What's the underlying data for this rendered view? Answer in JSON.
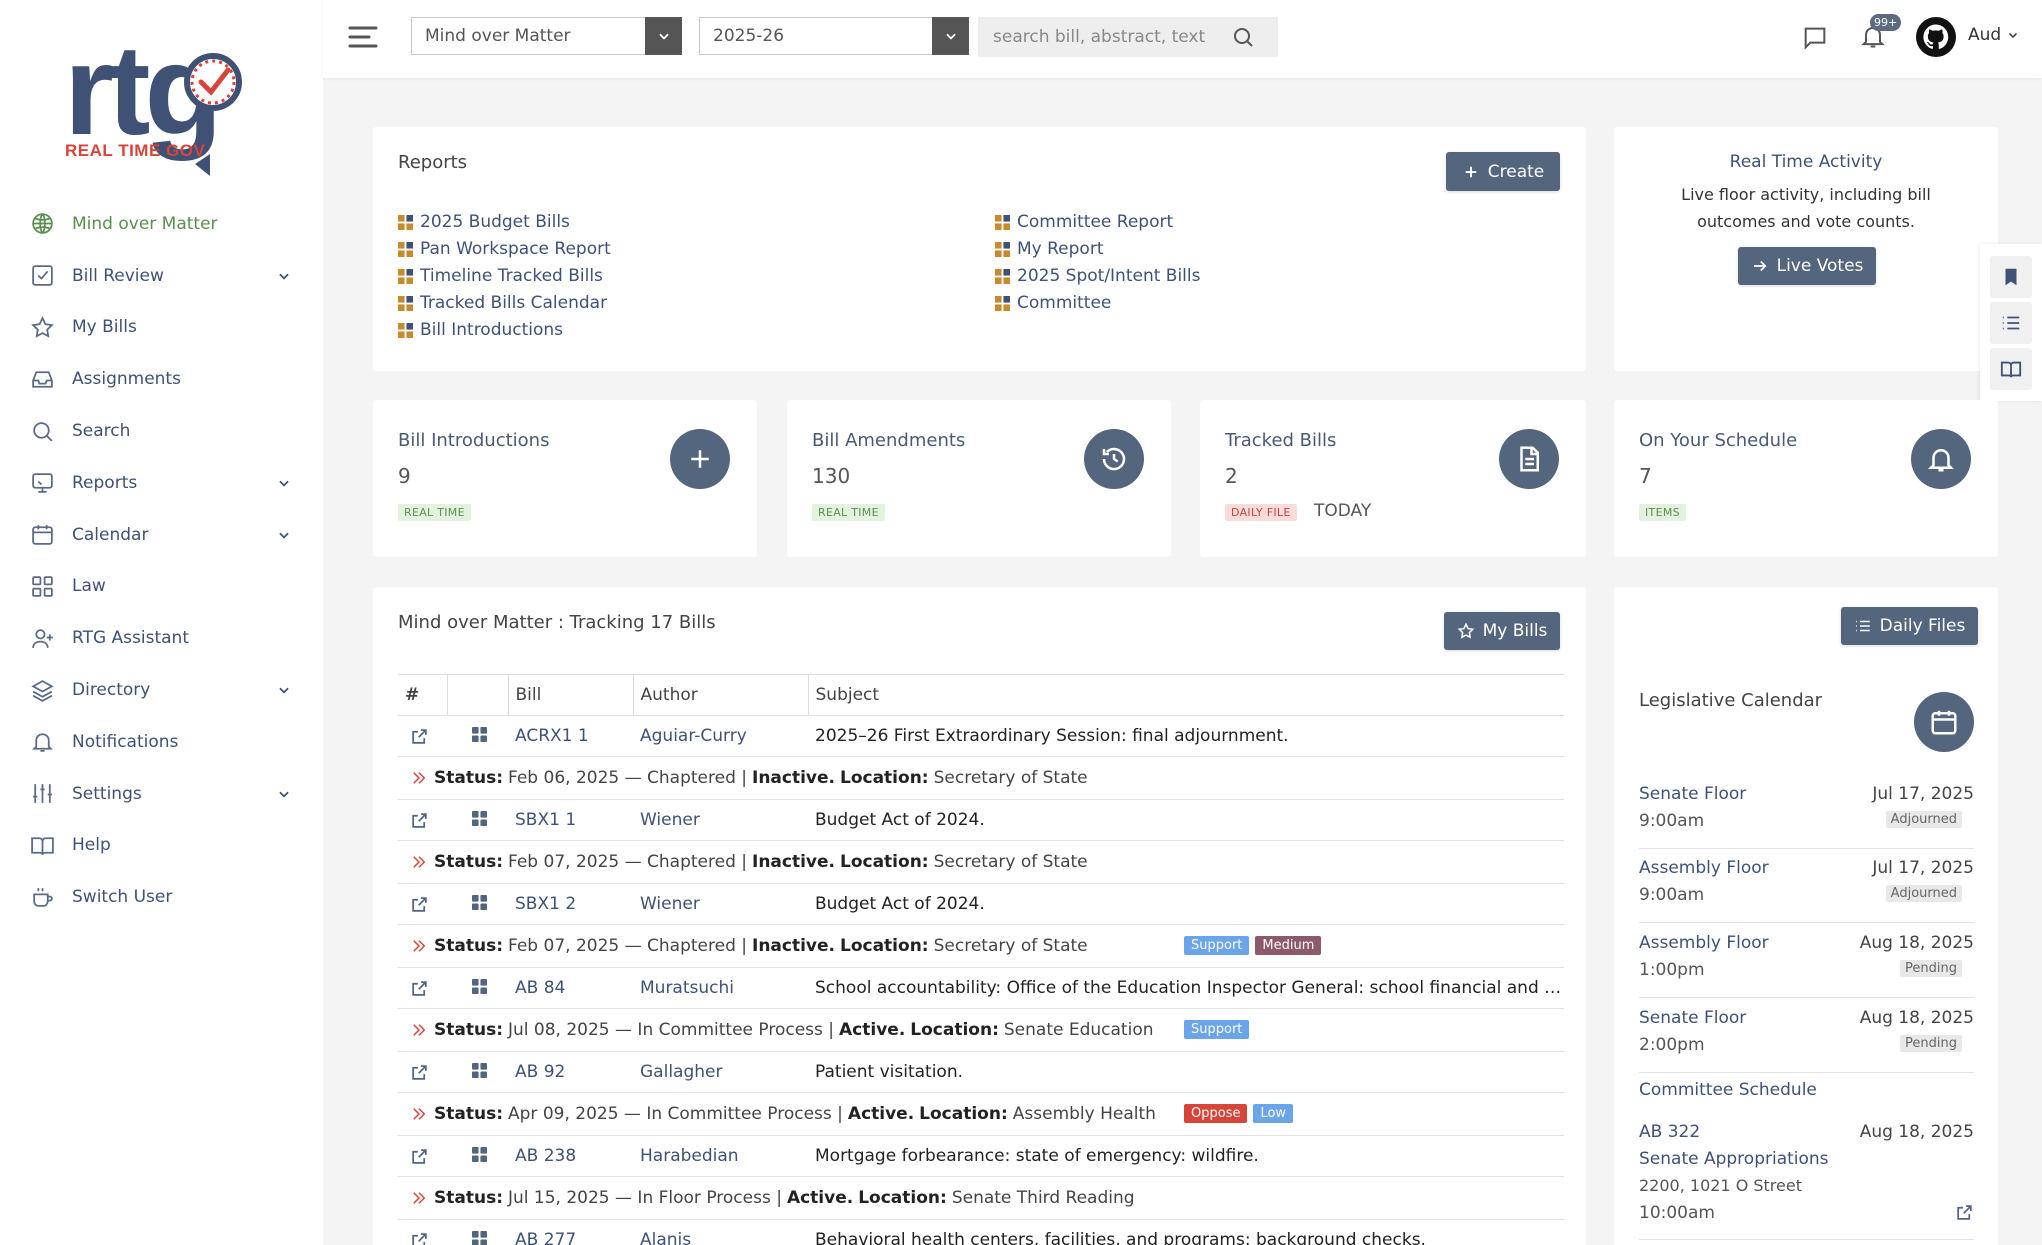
{
  "logo": {
    "text": "rtg",
    "subtitle": "REAL TIME GOV"
  },
  "sidebar": {
    "items": [
      {
        "label": "Mind over Matter",
        "icon": "globe-icon",
        "active": true,
        "chevron": false
      },
      {
        "label": "Bill Review",
        "icon": "checklist-icon",
        "chevron": true
      },
      {
        "label": "My Bills",
        "icon": "star-icon",
        "chevron": false
      },
      {
        "label": "Assignments",
        "icon": "inbox-icon",
        "chevron": false
      },
      {
        "label": "Search",
        "icon": "search-icon",
        "chevron": false
      },
      {
        "label": "Reports",
        "icon": "monitor-icon",
        "chevron": true
      },
      {
        "label": "Calendar",
        "icon": "calendar-icon",
        "chevron": true
      },
      {
        "label": "Law",
        "icon": "grid-icon",
        "chevron": false
      },
      {
        "label": "RTG Assistant",
        "icon": "user-plus-icon",
        "chevron": false
      },
      {
        "label": "Directory",
        "icon": "layers-icon",
        "chevron": true
      },
      {
        "label": "Notifications",
        "icon": "bell-icon",
        "chevron": false
      },
      {
        "label": "Settings",
        "icon": "sliders-icon",
        "chevron": true
      },
      {
        "label": "Help",
        "icon": "book-icon",
        "chevron": false
      },
      {
        "label": "Switch User",
        "icon": "coffee-icon",
        "chevron": false
      }
    ]
  },
  "topbar": {
    "workspace": "Mind over Matter",
    "session": "2025-26",
    "search_placeholder": "search bill, abstract, text",
    "notif_count": "99+",
    "user": "Aud"
  },
  "reports": {
    "title": "Reports",
    "create_label": "Create",
    "left": [
      "2025 Budget Bills",
      "Pan Workspace Report",
      "Timeline Tracked Bills",
      "Tracked Bills Calendar",
      "Bill Introductions"
    ],
    "right": [
      "Committee Report",
      "My Report",
      "2025 Spot/Intent Bills",
      "Committee"
    ]
  },
  "activity": {
    "title": "Real Time Activity",
    "text": "Live floor activity, including bill outcomes and vote counts.",
    "button": "Live Votes"
  },
  "stats": [
    {
      "label": "Bill Introductions",
      "value": "9",
      "tag": "REAL TIME",
      "tag_color": "green",
      "icon": "plus-icon"
    },
    {
      "label": "Bill Amendments",
      "value": "130",
      "tag": "REAL TIME",
      "tag_color": "green",
      "icon": "history-icon"
    },
    {
      "label": "Tracked Bills",
      "value": "2",
      "tag": "DAILY FILE",
      "tag_color": "red",
      "extra": "TODAY",
      "icon": "document-icon"
    },
    {
      "label": "On Your Schedule",
      "value": "7",
      "tag": "ITEMS",
      "tag_color": "green",
      "icon": "bell-icon"
    }
  ],
  "tracking": {
    "title": "Mind over Matter : Tracking 17 Bills",
    "button": "My Bills",
    "headers": [
      "#",
      "",
      "Bill",
      "Author",
      "Subject"
    ],
    "rows": [
      {
        "bill": "ACRX1 1",
        "author": "Aguiar-Curry",
        "subject": "2025–26 First Extraordinary Session: final adjournment.",
        "status_label": "Status:",
        "status": "Feb 06, 2025 — Chaptered |",
        "state": "Inactive.",
        "loc_label": "Location:",
        "location": "Secretary of State",
        "tags": []
      },
      {
        "bill": "SBX1 1",
        "author": "Wiener",
        "subject": "Budget Act of 2024.",
        "status_label": "Status:",
        "status": "Feb 07, 2025 — Chaptered |",
        "state": "Inactive.",
        "loc_label": "Location:",
        "location": "Secretary of State",
        "tags": []
      },
      {
        "bill": "SBX1 2",
        "author": "Wiener",
        "subject": "Budget Act of 2024.",
        "status_label": "Status:",
        "status": "Feb 07, 2025 — Chaptered |",
        "state": "Inactive.",
        "loc_label": "Location:",
        "location": "Secretary of State",
        "tags": [
          {
            "text": "Support",
            "kind": "support"
          },
          {
            "text": "Medium",
            "kind": "medium"
          }
        ]
      },
      {
        "bill": "AB 84",
        "author": "Muratsuchi",
        "subject": "School accountability: Office of the Education Inspector General: school financial and …",
        "status_label": "Status:",
        "status": "Jul 08, 2025 — In Committee Process |",
        "state": "Active.",
        "loc_label": "Location:",
        "location": "Senate Education",
        "tags": [
          {
            "text": "Support",
            "kind": "support"
          }
        ]
      },
      {
        "bill": "AB 92",
        "author": "Gallagher",
        "subject": "Patient visitation.",
        "status_label": "Status:",
        "status": "Apr 09, 2025 — In Committee Process |",
        "state": "Active.",
        "loc_label": "Location:",
        "location": "Assembly Health",
        "tags": [
          {
            "text": "Oppose",
            "kind": "oppose"
          },
          {
            "text": "Low",
            "kind": "low"
          }
        ]
      },
      {
        "bill": "AB 238",
        "author": "Harabedian",
        "subject": "Mortgage forbearance: state of emergency: wildfire.",
        "status_label": "Status:",
        "status": "Jul 15, 2025 — In Floor Process |",
        "state": "Active.",
        "loc_label": "Location:",
        "location": "Senate Third Reading",
        "tags": []
      },
      {
        "bill": "AB 277",
        "author": "Alanis",
        "subject": "Behavioral health centers, facilities, and programs: background checks.",
        "status": null
      }
    ]
  },
  "calendar": {
    "daily_files_label": "Daily Files",
    "title": "Legislative Calendar",
    "items": [
      {
        "name": "Senate Floor",
        "date": "Jul 17, 2025",
        "time": "9:00am",
        "badge": "Adjourned"
      },
      {
        "name": "Assembly Floor",
        "date": "Jul 17, 2025",
        "time": "9:00am",
        "badge": "Adjourned"
      },
      {
        "name": "Assembly Floor",
        "date": "Aug 18, 2025",
        "time": "1:00pm",
        "badge": "Pending"
      },
      {
        "name": "Senate Floor",
        "date": "Aug 18, 2025",
        "time": "2:00pm",
        "badge": "Pending"
      }
    ],
    "committee_title": "Committee Schedule",
    "committee": {
      "bill": "AB 322",
      "date": "Aug 18, 2025",
      "name": "Senate Appropriations",
      "room": "2200, 1021 O Street",
      "time": "10:00am"
    }
  },
  "colors": {
    "accent": "#54657e",
    "link": "#3f5275",
    "active": "#5a8f4f",
    "status_red": "#d6453a",
    "support_blue": "#6aa5ea"
  }
}
